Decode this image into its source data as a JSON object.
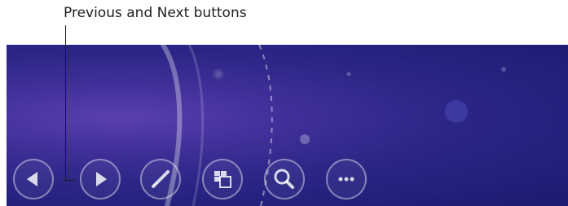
{
  "callout": {
    "text": "Previous and Next buttons"
  },
  "colors": {
    "slide_background": "#2c2686",
    "slide_highlight": "#5a3fb0",
    "control_stroke": "#ffffff"
  },
  "toolbar": {
    "buttons": [
      {
        "name": "previous-button",
        "icon": "triangle-left-icon"
      },
      {
        "name": "next-button",
        "icon": "triangle-right-icon"
      },
      {
        "name": "pen-button",
        "icon": "pen-icon"
      },
      {
        "name": "see-all-slides-button",
        "icon": "slides-grid-icon"
      },
      {
        "name": "zoom-button",
        "icon": "magnifier-icon"
      },
      {
        "name": "more-options-button",
        "icon": "ellipsis-icon"
      }
    ]
  }
}
